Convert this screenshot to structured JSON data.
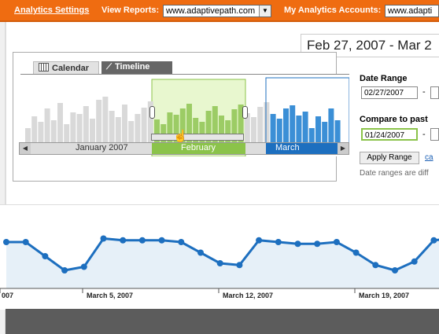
{
  "topbar": {
    "analytics_settings": "Analytics Settings",
    "view_reports_label": "View Reports:",
    "view_reports_value": "www.adaptivepath.com",
    "my_accounts_label": "My Analytics Accounts:",
    "my_accounts_value": "www.adapti"
  },
  "header": {
    "date_range_text": "Feb 27, 2007 - Mar 2"
  },
  "tabs": {
    "calendar": "Calendar",
    "timeline": "Timeline"
  },
  "timeline": {
    "months": [
      "January 2007",
      "February",
      "March"
    ],
    "colors": {
      "gray": "#d9d9d9",
      "green_selection": "#9ccc65",
      "green_bg": "#e8f7cf",
      "blue": "#3b8fd6",
      "blue_dark": "#1d6fbf"
    }
  },
  "range_controls": {
    "date_range_label": "Date Range",
    "date_range_start": "02/27/2007",
    "dash": "-",
    "compare_label": "Compare to past",
    "compare_start": "01/24/2007",
    "apply_label": "Apply Range",
    "cancel_label": "ca",
    "note": "Date ranges are diff"
  },
  "chart_data": {
    "type": "line",
    "x_tick_labels": [
      "007",
      "March 5, 2007",
      "March 12, 2007",
      "March 19, 2007"
    ],
    "values": [
      48,
      48,
      40,
      32,
      34,
      50,
      49,
      49,
      49,
      48,
      42,
      36,
      35,
      49,
      48,
      47,
      47,
      48,
      42,
      35,
      32,
      37,
      49,
      50,
      47,
      48,
      48
    ]
  }
}
